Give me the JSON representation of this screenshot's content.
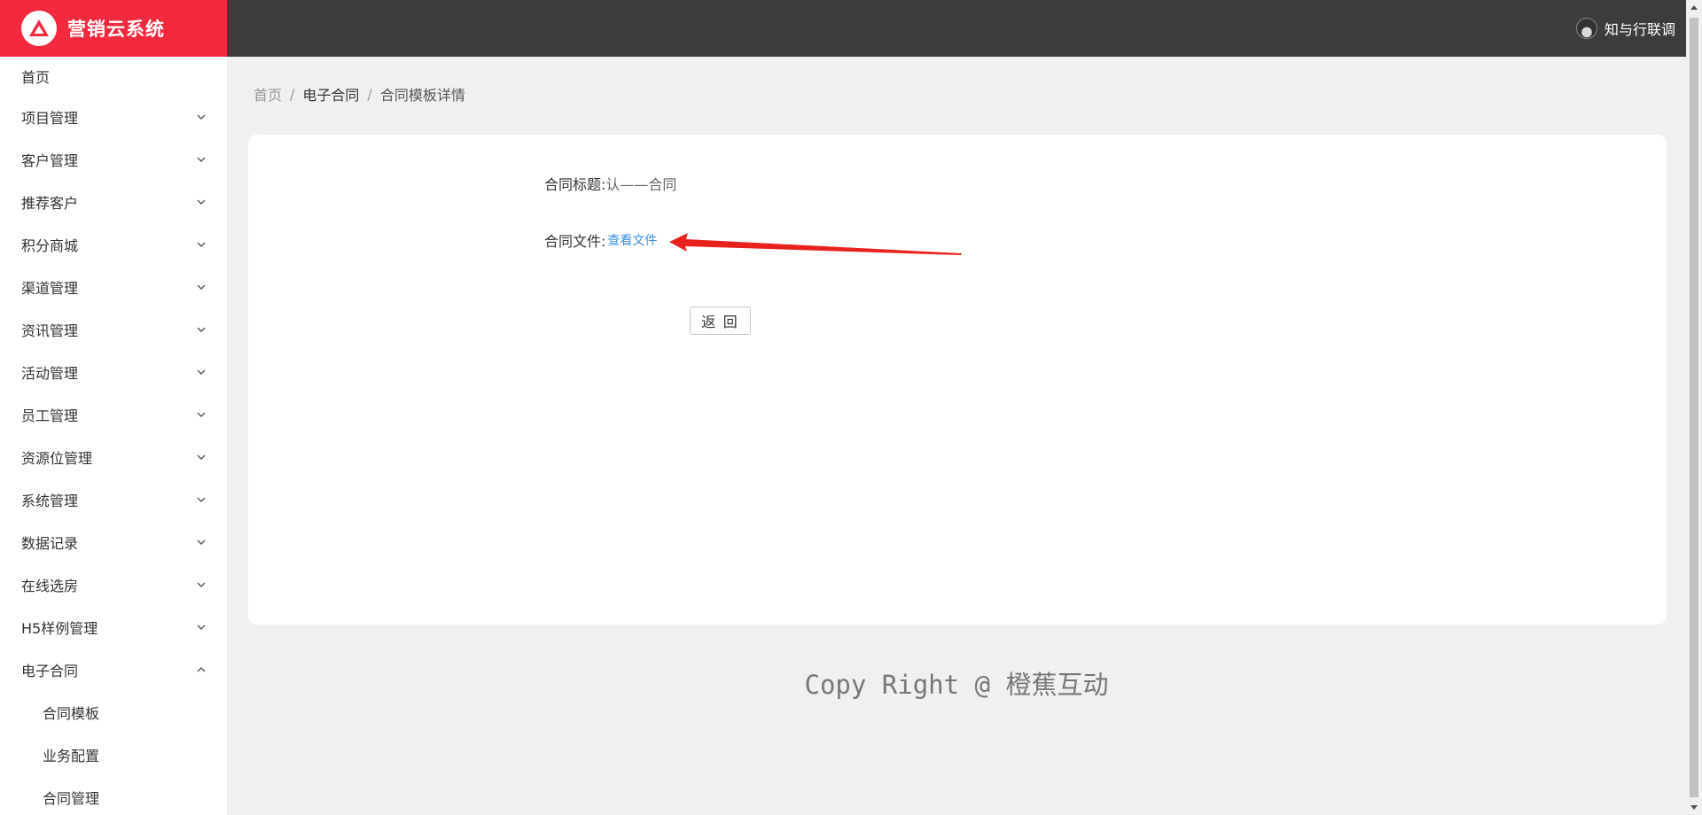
{
  "brand": {
    "title": "营销云系统",
    "color": "#f2293f"
  },
  "topbar": {
    "username": "知与行联调",
    "color": "#3c3d3b"
  },
  "sidebar": {
    "home": "首页",
    "items": [
      {
        "label": "项目管理",
        "icon": "chevron-down-icon"
      },
      {
        "label": "客户管理",
        "icon": "chevron-down-icon"
      },
      {
        "label": "推荐客户",
        "icon": "chevron-down-icon"
      },
      {
        "label": "积分商城",
        "icon": "chevron-down-icon"
      },
      {
        "label": "渠道管理",
        "icon": "chevron-down-icon"
      },
      {
        "label": "资讯管理",
        "icon": "chevron-down-icon"
      },
      {
        "label": "活动管理",
        "icon": "chevron-down-icon"
      },
      {
        "label": "员工管理",
        "icon": "chevron-down-icon"
      },
      {
        "label": "资源位管理",
        "icon": "chevron-down-icon"
      },
      {
        "label": "系统管理",
        "icon": "chevron-down-icon"
      },
      {
        "label": "数据记录",
        "icon": "chevron-down-icon"
      },
      {
        "label": "在线选房",
        "icon": "chevron-down-icon"
      },
      {
        "label": "H5样例管理",
        "icon": "chevron-down-icon"
      },
      {
        "label": "电子合同",
        "icon": "chevron-up-icon",
        "expanded": true
      }
    ],
    "submenu": [
      "合同模板",
      "业务配置",
      "合同管理"
    ]
  },
  "breadcrumb": {
    "home": "首页",
    "section": "电子合同",
    "current": "合同模板详情",
    "separator": "/"
  },
  "detail": {
    "title_label": "合同标题:",
    "title_value": "认——合同",
    "file_label": "合同文件:",
    "file_link": "查看文件",
    "link_color": "#3a8ee6"
  },
  "back_button": "返 回",
  "annotation": {
    "arrow_color": "#e8231e"
  },
  "footer": "Copy Right @ 橙蕉互动"
}
